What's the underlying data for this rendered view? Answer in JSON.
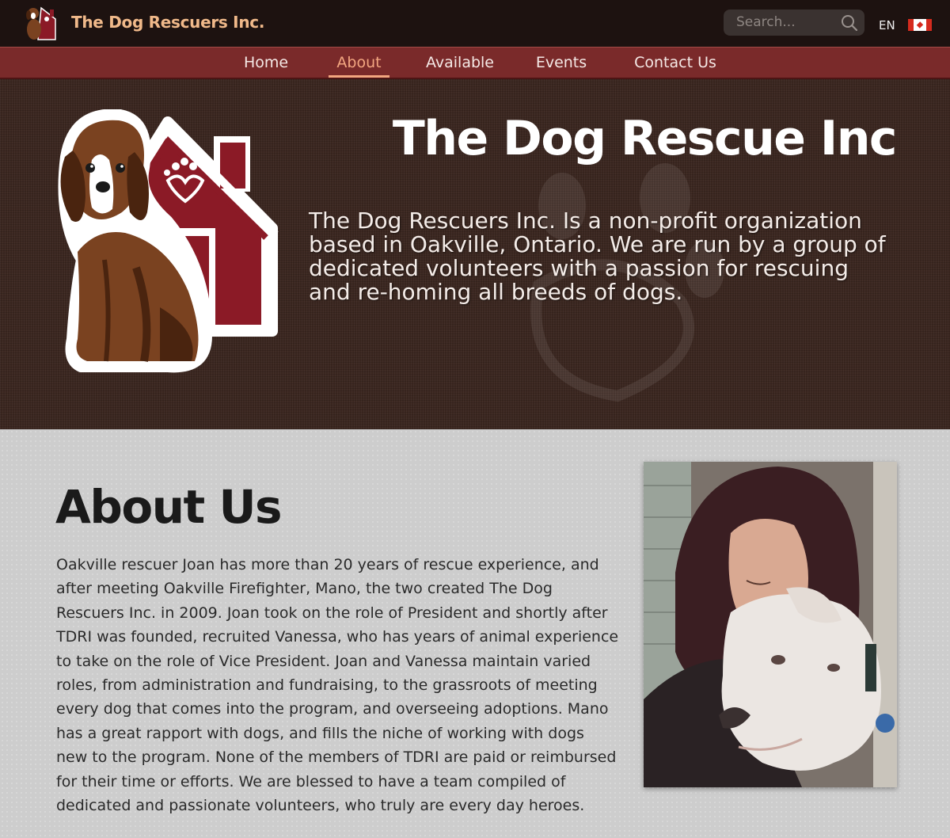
{
  "header": {
    "brand": "The Dog Rescuers Inc.",
    "search_placeholder": "Search...",
    "language": "EN"
  },
  "nav": {
    "items": [
      {
        "label": "Home",
        "active": false
      },
      {
        "label": "About",
        "active": true
      },
      {
        "label": "Available",
        "active": false
      },
      {
        "label": "Events",
        "active": false
      },
      {
        "label": "Contact Us",
        "active": false
      }
    ]
  },
  "hero": {
    "title": "The Dog Rescue Inc",
    "text": "The Dog Rescuers Inc. Is a non-profit organization based in Oakville, Ontario. We are run by a group of dedicated volunteers with a passion for rescuing and re-homing all breeds of dogs."
  },
  "about": {
    "title": "About Us",
    "text": "Oakville rescuer Joan has more than 20 years of rescue experience, and after meeting Oakville Firefighter, Mano, the two created The Dog Rescuers Inc. in 2009. Joan took on the role of President and shortly after TDRI was founded, recruited Vanessa, who has years of animal experience  to take on the role of Vice President. Joan and Vanessa  maintain varied roles, from administration and fundraising, to the grassroots of meeting every dog that comes into the program, and overseeing adoptions. Mano has a great rapport with dogs, and fills the niche of working with dogs new to the program. None of the members  of TDRI are paid or reimbursed  for their time or efforts. We are blessed to have a team compiled of dedicated and passionate volunteers, who truly are every day heroes."
  },
  "colors": {
    "topbar": "#1d1210",
    "navbar": "#7a2a2a",
    "brand": "#f0b98a",
    "nav_active": "#f3a680",
    "hero_bg": "#3b2720",
    "house": "#8b1a26",
    "dog": "#7a4220"
  },
  "icons": [
    "logo-icon",
    "search-icon",
    "canada-flag-icon",
    "paw-icon"
  ]
}
